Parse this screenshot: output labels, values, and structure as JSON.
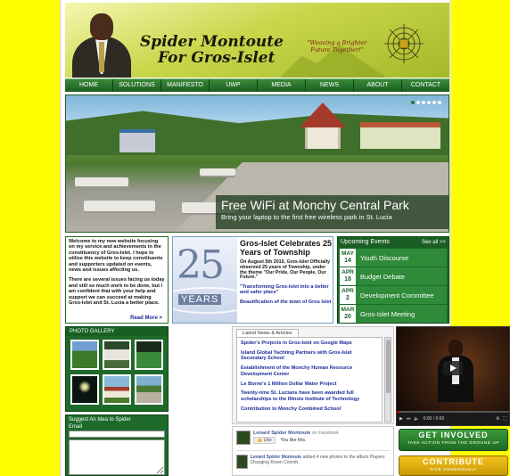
{
  "header": {
    "title_line1": "Spider Montoute",
    "title_line2": "For Gros-Islet",
    "slogan": "\"Weaving a Brighter Future Together!\""
  },
  "nav": [
    "HOME",
    "SOLUTIONS",
    "MANIFESTO",
    "UWP",
    "MEDIA",
    "NEWS",
    "ABOUT",
    "CONTACT"
  ],
  "hero": {
    "title": "Free WiFi at Monchy Central Park",
    "subtitle": "Bring your laptop to the first free wireless park in St. Lucia"
  },
  "welcome": {
    "para1": "Welcome to my new website focusing on my service and achievements in the constituency of Gros-Islet. I hope to utilize this website to keep constituents and supporters updated on events, news and issues affecting us.",
    "para2": "There are several issues facing us today and still so much work to be done, but I am confident that with your help and support we can succeed at making Gros-Islet and St. Lucia a better place.",
    "more": "Read More >"
  },
  "feature": {
    "years_number": "25",
    "years_label": "YEARS",
    "title": "Gros-Islet Celebrates 25 Years of Township",
    "body": "On August 5th 2010, Gros-Islet Officially observed 25 years of Township, under the theme \"Our Pride, Our People, Our Future.\"",
    "link1": "\"Transforming Gros-Islet into a better and safer place\"",
    "link2": "Beautification of the town of Gros Islet"
  },
  "events": {
    "heading": "Upcoming Events",
    "see_all": "See all >>",
    "items": [
      {
        "month": "MAY",
        "day": "14",
        "title": "Youth Discourse"
      },
      {
        "month": "APR",
        "day": "18",
        "title": "Budget Debate"
      },
      {
        "month": "APR",
        "day": "2",
        "title": "Development Committee"
      },
      {
        "month": "MAR",
        "day": "20",
        "title": "Gros-Islet Meeting"
      }
    ]
  },
  "gallery": {
    "heading": "PHOTO GALLERY"
  },
  "suggest": {
    "heading": "Suggest An Idea to Spider",
    "email_label": "Email"
  },
  "news": {
    "tab": "Latest News & Articles",
    "items": [
      "Spider's Projects in Gros-Islet on Google Maps",
      "Island Global Yachting Partners with Gros-Islet Secondary School",
      "Establishment of the Monchy Human Resource Development Center",
      "Le Borne's 1 Million Dollar Water Project",
      "Twenty-nine St. Lucians have been awarded full scholarships to the Illinois Institute of Technology",
      "Contribution to Monchy Combined School"
    ]
  },
  "video": {
    "time": "0:00 / 0:00"
  },
  "facebook": {
    "page_name": "Lenard Spider Montoute",
    "on_facebook": "on Facebook",
    "like_label": "Like",
    "likes_text": "You like this.",
    "post_author": "Lenard Spider Montoute",
    "post_text": "added 4 new photos to the album Players Changing Room Corinth."
  },
  "buttons": {
    "get_involved": "GET INVOLVED",
    "get_involved_sub": "TAKE ACTION FROM THE GROUND UP",
    "contribute": "CONTRIBUTE",
    "contribute_sub": "GIVE GENEROUSLY"
  },
  "colors": {
    "background": "#ffff00",
    "nav_green": "#1d5e22",
    "panel_green": "#1d6a2a",
    "link_blue": "#1a2a9a",
    "contribute_gold": "#f4c21a"
  }
}
